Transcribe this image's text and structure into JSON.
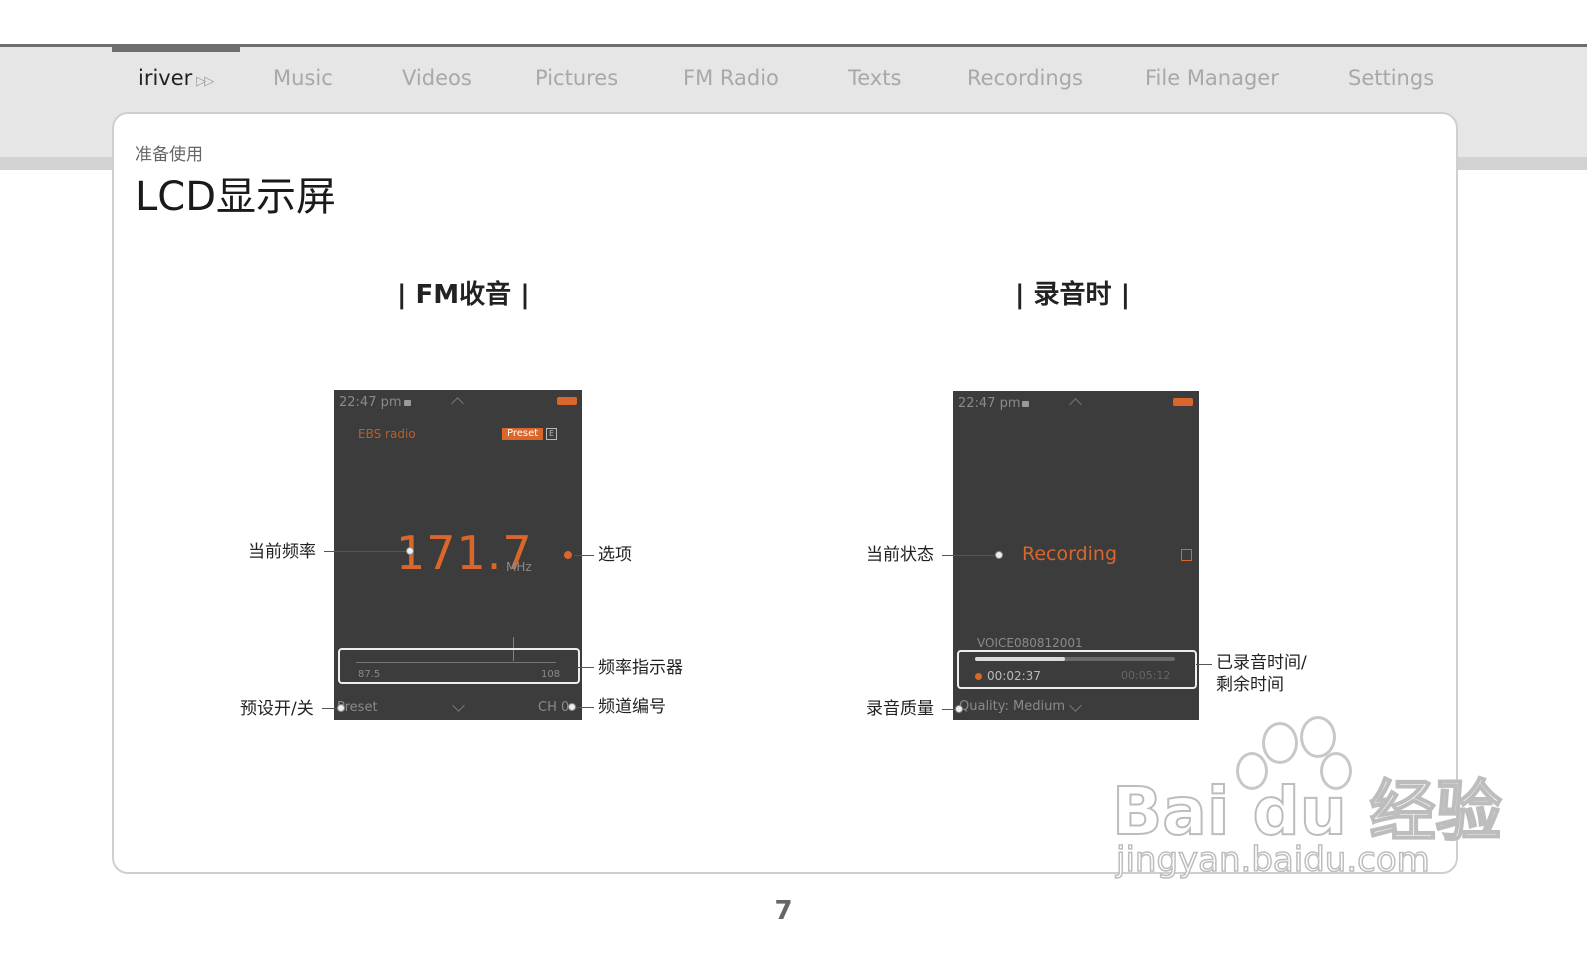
{
  "nav": {
    "brand": "iriver",
    "items": [
      "Music",
      "Videos",
      "Pictures",
      "FM Radio",
      "Texts",
      "Recordings",
      "File Manager",
      "Settings"
    ]
  },
  "header": {
    "subtitle": "准备使用",
    "title": "LCD显示屏"
  },
  "fm": {
    "section_title": "| FM收音 |",
    "screen": {
      "time": "22:47 pm",
      "station": "EBS radio",
      "preset_badge": "Preset",
      "badge_num": "E",
      "frequency": "171.7",
      "unit": "MHz",
      "scale_min": "87.5",
      "scale_max": "108",
      "preset_label": "Preset",
      "channel": "CH 0"
    },
    "callouts": {
      "current_freq": "当前频率",
      "option": "选项",
      "freq_indicator": "频率指示器",
      "preset_toggle": "预设开/关",
      "channel_num": "频道编号"
    }
  },
  "rec": {
    "section_title": "| 录音时 |",
    "screen": {
      "time": "22:47 pm",
      "status": "Recording",
      "filename": "VOICE080812001",
      "elapsed": "00:02:37",
      "remaining": "00:05:12",
      "quality": "Quality: Medium"
    },
    "callouts": {
      "current_status": "当前状态",
      "rec_time_1": "已录音时间/",
      "rec_time_2": "剩余时间",
      "quality": "录音质量"
    }
  },
  "footer": {
    "page": "7"
  },
  "watermark": {
    "brand": "Bai du 经验",
    "url": "jingyan.baidu.com"
  },
  "colors": {
    "accent": "#d9662a",
    "screen_bg": "#3c3c3c",
    "tab_bg": "#e6e6e6"
  }
}
